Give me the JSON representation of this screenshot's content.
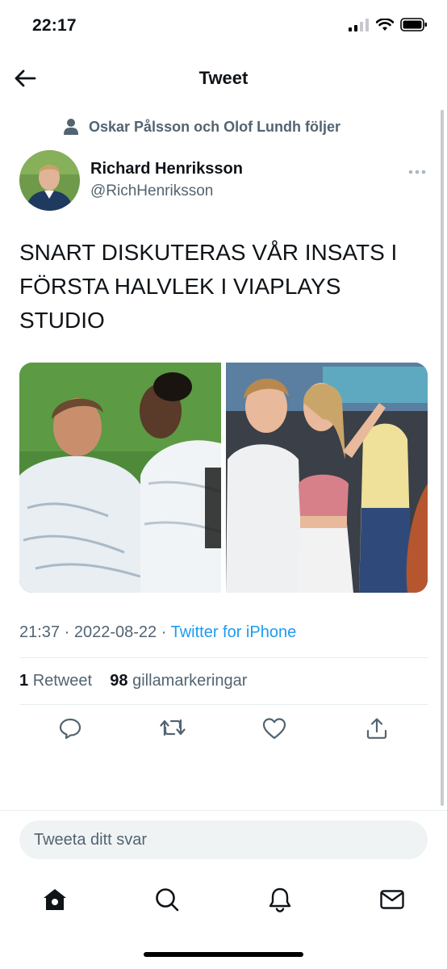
{
  "status": {
    "time": "22:17"
  },
  "header": {
    "title": "Tweet"
  },
  "social_context": {
    "text": "Oskar Pålsson och Olof Lundh följer"
  },
  "author": {
    "name": "Richard Henriksson",
    "handle": "@RichHenriksson"
  },
  "tweet": {
    "text": "SNART DISKUTERAS VÅR INSATS I FÖRSTA HALVLEK I VIAPLAYS STUDIO",
    "time": "21:37",
    "date": "2022-08-22",
    "source": "Twitter for iPhone",
    "separator": " · "
  },
  "stats": {
    "retweets_count": "1",
    "retweets_label": "Retweet",
    "likes_count": "98",
    "likes_label": "gillamarkeringar"
  },
  "reply": {
    "placeholder": "Tweeta ditt svar"
  },
  "icons": {
    "back": "back-arrow-icon",
    "social": "person-icon",
    "more": "more-icon",
    "reply": "reply-icon",
    "retweet": "retweet-icon",
    "like": "heart-icon",
    "share": "share-icon",
    "home": "home-icon",
    "search": "search-icon",
    "notifications": "bell-icon",
    "messages": "mail-icon"
  },
  "colors": {
    "link": "#1d9bf0",
    "secondary": "#536471"
  }
}
